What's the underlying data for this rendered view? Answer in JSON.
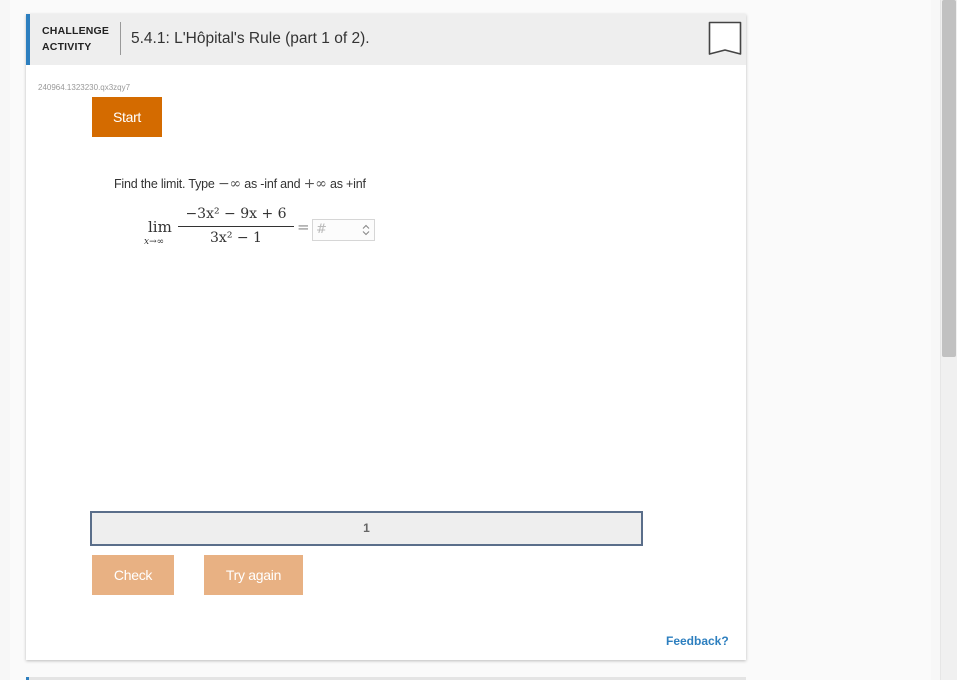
{
  "header": {
    "label_line1": "CHALLENGE",
    "label_line2": "ACTIVITY",
    "title": "5.4.1: L'Hôpital's Rule (part 1 of 2).",
    "bookmark_icon": "bookmark-icon"
  },
  "activity_id": "240964.1323230.qx3zqy7",
  "start_label": "Start",
  "instruction": {
    "prefix": "Find the limit. Type ",
    "neg_inf": "−∞",
    "middle": " as -inf and ",
    "pos_inf": "+∞",
    "suffix": " as +inf"
  },
  "math": {
    "lim": "lim",
    "lim_sub": "x→∞",
    "numerator": "−3x² − 9x + 6",
    "denominator": "3x² − 1",
    "equals": "=",
    "answer_placeholder": "#",
    "answer_value": ""
  },
  "progress": {
    "current_step": "1"
  },
  "buttons": {
    "check_label": "Check",
    "try_again_label": "Try again"
  },
  "feedback_label": "Feedback?",
  "colors": {
    "accent_blue": "#2d7fbf",
    "start_orange": "#d46b00",
    "disabled_orange": "#e8b183"
  }
}
